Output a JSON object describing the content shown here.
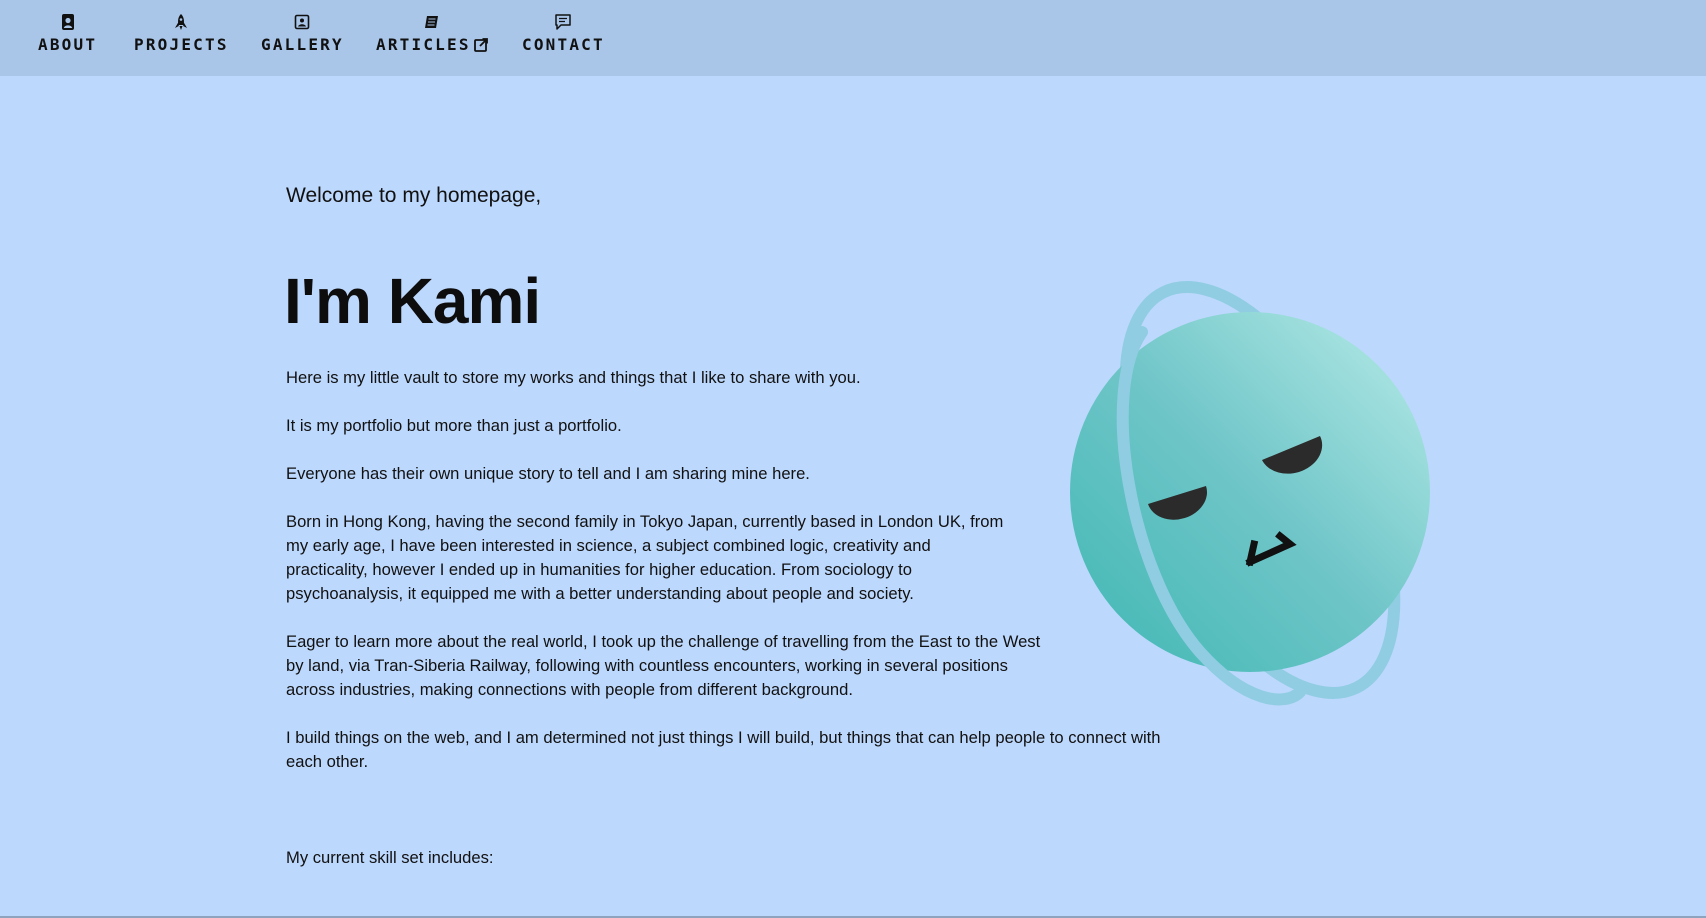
{
  "nav": {
    "items": [
      {
        "label": "ABOUT",
        "icon": "contact-card-icon"
      },
      {
        "label": "PROJECTS",
        "icon": "rocket-icon"
      },
      {
        "label": "GALLERY",
        "icon": "image-icon"
      },
      {
        "label": "ARTICLES",
        "icon": "notebook-icon",
        "external_icon": "external-link-icon"
      },
      {
        "label": "CONTACT",
        "icon": "chat-icon"
      }
    ]
  },
  "hero": {
    "welcome": "Welcome to my homepage,",
    "title": "I'm Kami",
    "paragraphs": [
      "Here is my little vault to store my works and things that I like to share with you.",
      "It is my portfolio but more than just a portfolio.",
      "Everyone has their own unique story to tell and I am sharing mine here.",
      "Born in Hong Kong, having the second family in Tokyo Japan, currently based in London UK, from my early age, I have been interested in science, a subject combined logic, creativity and practicality, however I ended up in humanities for higher education. From sociology to psychoanalysis, it equipped me with a better understanding about people and society.",
      "Eager to learn more about the real world, I took up the challenge of travelling from the East to the West by land, via Tran-Siberia Railway, following with countless encounters, working in several positions across industries, making connections with people from different background.",
      "I build things on the web, and I am determined not just things I will build, but things that can help people to connect with each other.",
      "My current skill set includes:"
    ]
  },
  "colors": {
    "background": "#bdd8fd",
    "nav_background": "#a9c5e8",
    "planet_start": "#3fb8b3",
    "planet_end": "#b8ece8",
    "ring": "#90cde2",
    "face": "#2b2b2b"
  }
}
